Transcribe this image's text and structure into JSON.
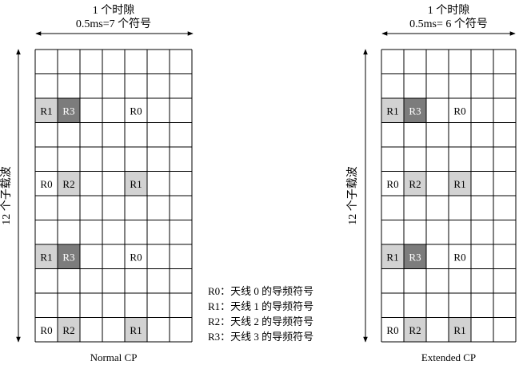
{
  "normal": {
    "slot_label": "1 个时隙",
    "symbols_label": "0.5ms=7 个符号",
    "subcarrier_label": "12 个子载波",
    "caption": "Normal CP",
    "columns": 7,
    "rows": 12,
    "cells": [
      {
        "row": 2,
        "col": 0,
        "text": "R1",
        "shade": "light"
      },
      {
        "row": 2,
        "col": 1,
        "text": "R3",
        "shade": "dark"
      },
      {
        "row": 2,
        "col": 4,
        "text": "R0",
        "shade": "none"
      },
      {
        "row": 5,
        "col": 0,
        "text": "R0",
        "shade": "none"
      },
      {
        "row": 5,
        "col": 1,
        "text": "R2",
        "shade": "light"
      },
      {
        "row": 5,
        "col": 4,
        "text": "R1",
        "shade": "light"
      },
      {
        "row": 8,
        "col": 0,
        "text": "R1",
        "shade": "light"
      },
      {
        "row": 8,
        "col": 1,
        "text": "R3",
        "shade": "dark"
      },
      {
        "row": 8,
        "col": 4,
        "text": "R0",
        "shade": "none"
      },
      {
        "row": 11,
        "col": 0,
        "text": "R0",
        "shade": "none"
      },
      {
        "row": 11,
        "col": 1,
        "text": "R2",
        "shade": "light"
      },
      {
        "row": 11,
        "col": 4,
        "text": "R1",
        "shade": "light"
      }
    ]
  },
  "extended": {
    "slot_label": "1 个时隙",
    "symbols_label": "0.5ms= 6 个符号",
    "subcarrier_label": "12 个子载波",
    "caption": "Extended CP",
    "columns": 6,
    "rows": 12,
    "cells": [
      {
        "row": 2,
        "col": 0,
        "text": "R1",
        "shade": "light"
      },
      {
        "row": 2,
        "col": 1,
        "text": "R3",
        "shade": "dark"
      },
      {
        "row": 2,
        "col": 3,
        "text": "R0",
        "shade": "none"
      },
      {
        "row": 5,
        "col": 0,
        "text": "R0",
        "shade": "none"
      },
      {
        "row": 5,
        "col": 1,
        "text": "R2",
        "shade": "light"
      },
      {
        "row": 5,
        "col": 3,
        "text": "R1",
        "shade": "light"
      },
      {
        "row": 8,
        "col": 0,
        "text": "R1",
        "shade": "light"
      },
      {
        "row": 8,
        "col": 1,
        "text": "R3",
        "shade": "dark"
      },
      {
        "row": 8,
        "col": 3,
        "text": "R0",
        "shade": "none"
      },
      {
        "row": 11,
        "col": 0,
        "text": "R0",
        "shade": "none"
      },
      {
        "row": 11,
        "col": 1,
        "text": "R2",
        "shade": "light"
      },
      {
        "row": 11,
        "col": 3,
        "text": "R1",
        "shade": "light"
      }
    ]
  },
  "legend": [
    "R0：天线 0 的导频符号",
    "R1：天线 1 的导频符号",
    "R2：天线 2 的导频符号",
    "R3：天线 3 的导频符号"
  ],
  "colors": {
    "light": "#d2d2d2",
    "dark": "#7c7c7c",
    "grid": "#000000",
    "text_on_dark": "#ffffff"
  }
}
